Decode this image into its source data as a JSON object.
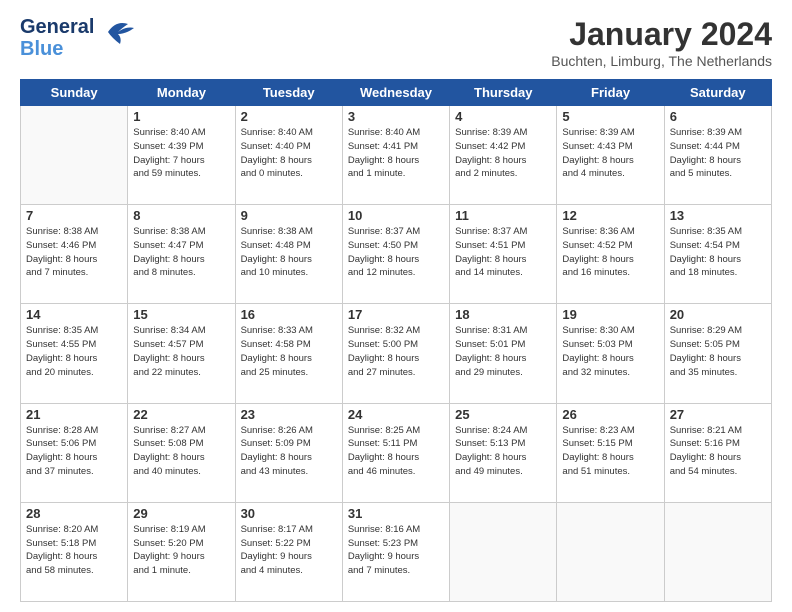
{
  "header": {
    "logo_line1": "General",
    "logo_line2": "Blue",
    "month_title": "January 2024",
    "location": "Buchten, Limburg, The Netherlands"
  },
  "weekdays": [
    "Sunday",
    "Monday",
    "Tuesday",
    "Wednesday",
    "Thursday",
    "Friday",
    "Saturday"
  ],
  "weeks": [
    [
      {
        "day": "",
        "info": ""
      },
      {
        "day": "1",
        "info": "Sunrise: 8:40 AM\nSunset: 4:39 PM\nDaylight: 7 hours\nand 59 minutes."
      },
      {
        "day": "2",
        "info": "Sunrise: 8:40 AM\nSunset: 4:40 PM\nDaylight: 8 hours\nand 0 minutes."
      },
      {
        "day": "3",
        "info": "Sunrise: 8:40 AM\nSunset: 4:41 PM\nDaylight: 8 hours\nand 1 minute."
      },
      {
        "day": "4",
        "info": "Sunrise: 8:39 AM\nSunset: 4:42 PM\nDaylight: 8 hours\nand 2 minutes."
      },
      {
        "day": "5",
        "info": "Sunrise: 8:39 AM\nSunset: 4:43 PM\nDaylight: 8 hours\nand 4 minutes."
      },
      {
        "day": "6",
        "info": "Sunrise: 8:39 AM\nSunset: 4:44 PM\nDaylight: 8 hours\nand 5 minutes."
      }
    ],
    [
      {
        "day": "7",
        "info": "Sunrise: 8:38 AM\nSunset: 4:46 PM\nDaylight: 8 hours\nand 7 minutes."
      },
      {
        "day": "8",
        "info": "Sunrise: 8:38 AM\nSunset: 4:47 PM\nDaylight: 8 hours\nand 8 minutes."
      },
      {
        "day": "9",
        "info": "Sunrise: 8:38 AM\nSunset: 4:48 PM\nDaylight: 8 hours\nand 10 minutes."
      },
      {
        "day": "10",
        "info": "Sunrise: 8:37 AM\nSunset: 4:50 PM\nDaylight: 8 hours\nand 12 minutes."
      },
      {
        "day": "11",
        "info": "Sunrise: 8:37 AM\nSunset: 4:51 PM\nDaylight: 8 hours\nand 14 minutes."
      },
      {
        "day": "12",
        "info": "Sunrise: 8:36 AM\nSunset: 4:52 PM\nDaylight: 8 hours\nand 16 minutes."
      },
      {
        "day": "13",
        "info": "Sunrise: 8:35 AM\nSunset: 4:54 PM\nDaylight: 8 hours\nand 18 minutes."
      }
    ],
    [
      {
        "day": "14",
        "info": "Sunrise: 8:35 AM\nSunset: 4:55 PM\nDaylight: 8 hours\nand 20 minutes."
      },
      {
        "day": "15",
        "info": "Sunrise: 8:34 AM\nSunset: 4:57 PM\nDaylight: 8 hours\nand 22 minutes."
      },
      {
        "day": "16",
        "info": "Sunrise: 8:33 AM\nSunset: 4:58 PM\nDaylight: 8 hours\nand 25 minutes."
      },
      {
        "day": "17",
        "info": "Sunrise: 8:32 AM\nSunset: 5:00 PM\nDaylight: 8 hours\nand 27 minutes."
      },
      {
        "day": "18",
        "info": "Sunrise: 8:31 AM\nSunset: 5:01 PM\nDaylight: 8 hours\nand 29 minutes."
      },
      {
        "day": "19",
        "info": "Sunrise: 8:30 AM\nSunset: 5:03 PM\nDaylight: 8 hours\nand 32 minutes."
      },
      {
        "day": "20",
        "info": "Sunrise: 8:29 AM\nSunset: 5:05 PM\nDaylight: 8 hours\nand 35 minutes."
      }
    ],
    [
      {
        "day": "21",
        "info": "Sunrise: 8:28 AM\nSunset: 5:06 PM\nDaylight: 8 hours\nand 37 minutes."
      },
      {
        "day": "22",
        "info": "Sunrise: 8:27 AM\nSunset: 5:08 PM\nDaylight: 8 hours\nand 40 minutes."
      },
      {
        "day": "23",
        "info": "Sunrise: 8:26 AM\nSunset: 5:09 PM\nDaylight: 8 hours\nand 43 minutes."
      },
      {
        "day": "24",
        "info": "Sunrise: 8:25 AM\nSunset: 5:11 PM\nDaylight: 8 hours\nand 46 minutes."
      },
      {
        "day": "25",
        "info": "Sunrise: 8:24 AM\nSunset: 5:13 PM\nDaylight: 8 hours\nand 49 minutes."
      },
      {
        "day": "26",
        "info": "Sunrise: 8:23 AM\nSunset: 5:15 PM\nDaylight: 8 hours\nand 51 minutes."
      },
      {
        "day": "27",
        "info": "Sunrise: 8:21 AM\nSunset: 5:16 PM\nDaylight: 8 hours\nand 54 minutes."
      }
    ],
    [
      {
        "day": "28",
        "info": "Sunrise: 8:20 AM\nSunset: 5:18 PM\nDaylight: 8 hours\nand 58 minutes."
      },
      {
        "day": "29",
        "info": "Sunrise: 8:19 AM\nSunset: 5:20 PM\nDaylight: 9 hours\nand 1 minute."
      },
      {
        "day": "30",
        "info": "Sunrise: 8:17 AM\nSunset: 5:22 PM\nDaylight: 9 hours\nand 4 minutes."
      },
      {
        "day": "31",
        "info": "Sunrise: 8:16 AM\nSunset: 5:23 PM\nDaylight: 9 hours\nand 7 minutes."
      },
      {
        "day": "",
        "info": ""
      },
      {
        "day": "",
        "info": ""
      },
      {
        "day": "",
        "info": ""
      }
    ]
  ]
}
